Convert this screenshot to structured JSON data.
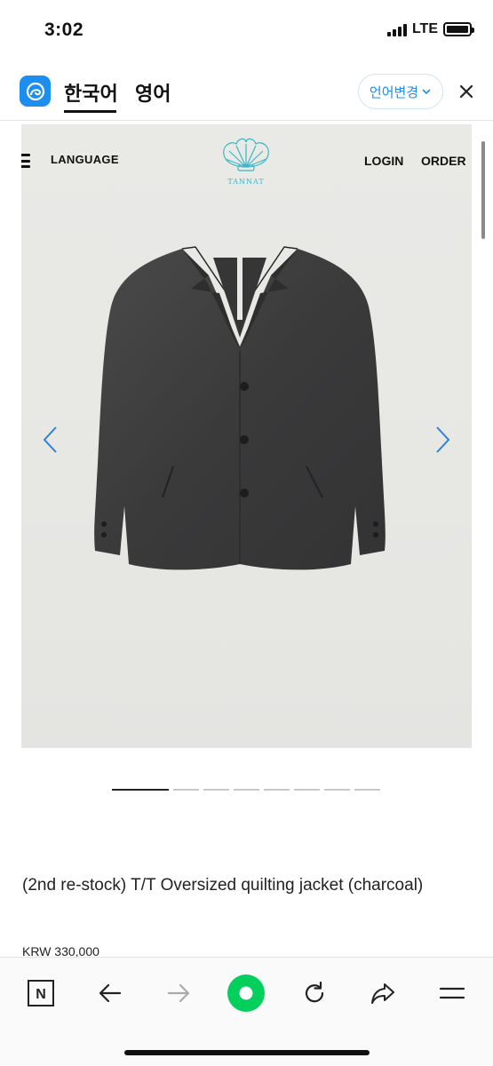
{
  "status_bar": {
    "time": "3:02",
    "network": "LTE",
    "signal_bars": 4,
    "battery_level": 1.0
  },
  "translate_bar": {
    "source_language": "한국어",
    "target_language": "영어",
    "change_language_label": "언어변경",
    "icons": [
      "papago-logo-icon",
      "chevron-down-icon",
      "close-icon"
    ],
    "accent_color": "#1b8ef0"
  },
  "site": {
    "header": {
      "menu_icon": "hamburger-menu-icon",
      "language_label": "LANGUAGE",
      "logo_text": "TANNAT",
      "login_label": "LOGIN",
      "order_label": "ORDER"
    },
    "gallery": {
      "image_subject": "charcoal oversized jacket",
      "slide_count": 9,
      "active_slide": 1,
      "prev_icon": "chevron-left-icon",
      "next_icon": "chevron-right-icon",
      "arrow_color": "#2f80d8"
    },
    "product": {
      "title": "(2nd re-stock) T/T Oversized quilting jacket (charcoal)",
      "price": "KRW 330,000"
    }
  },
  "toolbar": {
    "items": [
      {
        "name": "naver-home-icon",
        "label": "N"
      },
      {
        "name": "back-arrow-icon"
      },
      {
        "name": "forward-arrow-icon"
      },
      {
        "name": "green-dot-icon"
      },
      {
        "name": "refresh-icon"
      },
      {
        "name": "share-icon"
      },
      {
        "name": "menu-icon"
      }
    ],
    "green_color": "#03cf5d"
  }
}
